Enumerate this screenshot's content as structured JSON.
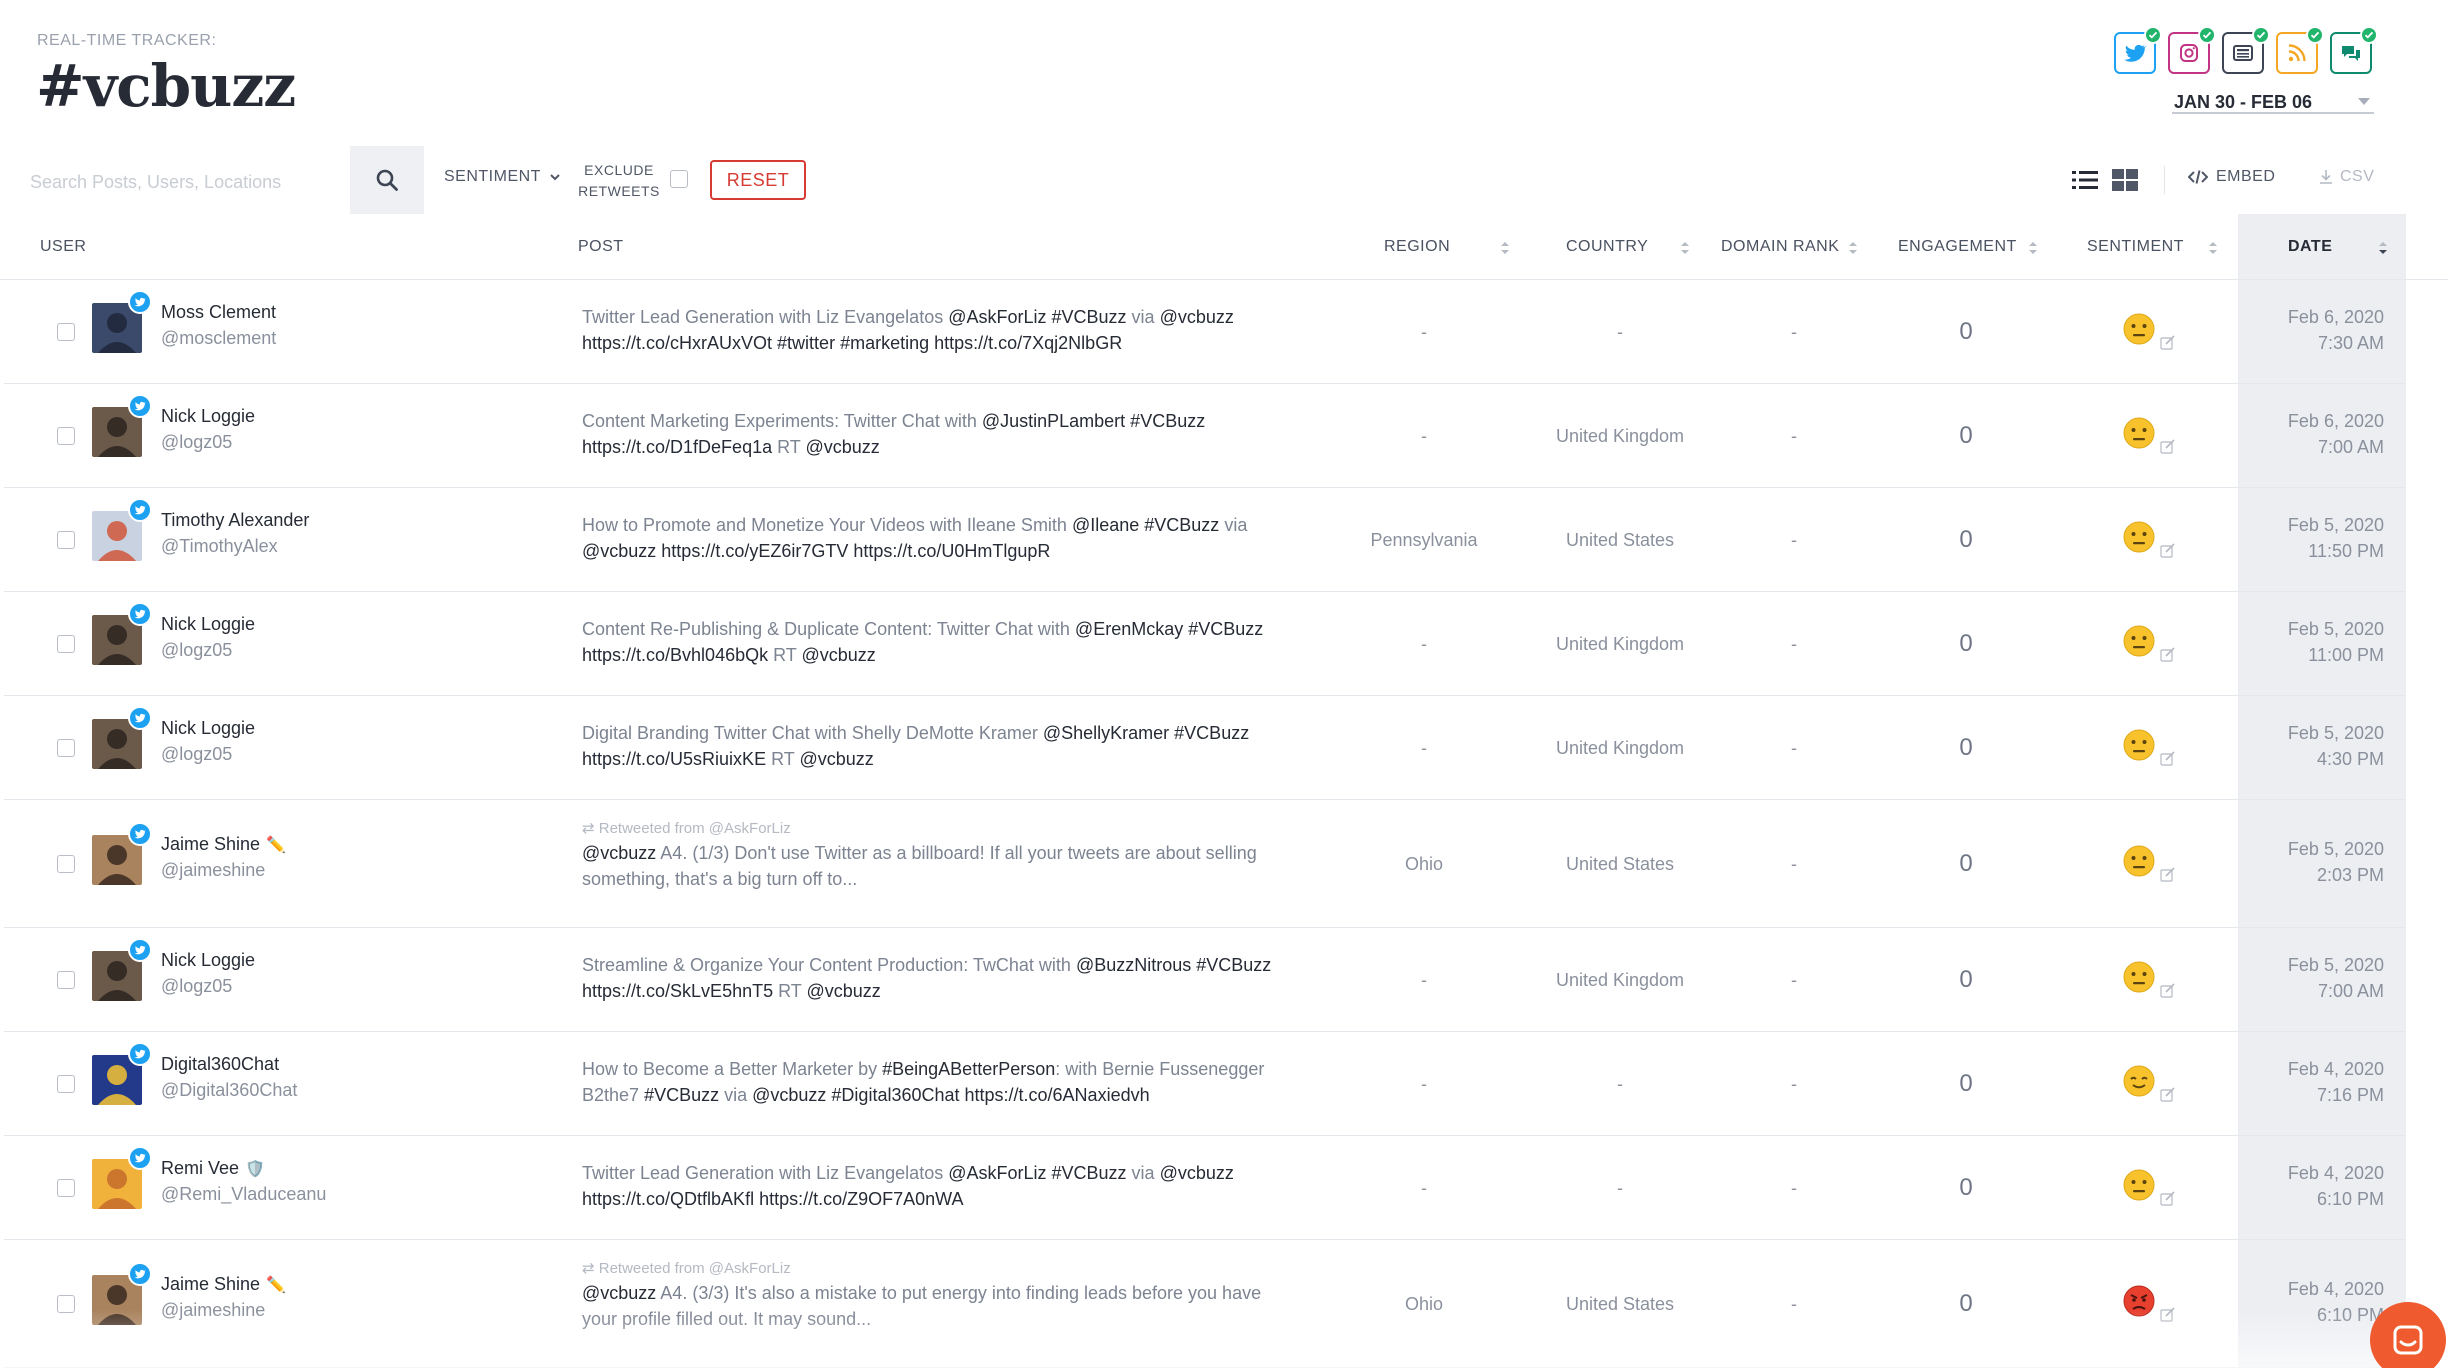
{
  "header": {
    "tracker_label": "REAL-TIME TRACKER:",
    "hashtag": "#vcbuzz",
    "date_range": "JAN 30 - FEB 06",
    "networks": [
      {
        "name": "twitter",
        "icon": "twitter-icon",
        "color": "#1da1f2"
      },
      {
        "name": "instagram",
        "icon": "instagram-icon",
        "color": "#c13584"
      },
      {
        "name": "news",
        "icon": "news-icon",
        "color": "#3d4454"
      },
      {
        "name": "rss",
        "icon": "rss-icon",
        "color": "#f5a623"
      },
      {
        "name": "forums",
        "icon": "forum-icon",
        "color": "#0f8a6e"
      }
    ]
  },
  "toolbar": {
    "search_placeholder": "Search Posts, Users, Locations",
    "sentiment_label": "SENTIMENT",
    "exclude_line1": "EXCLUDE",
    "exclude_line2": "RETWEETS",
    "reset_label": "RESET",
    "embed_label": "EMBED",
    "csv_label": "CSV"
  },
  "columns": {
    "user": "USER",
    "post": "POST",
    "region": "REGION",
    "country": "COUNTRY",
    "domain_rank": "DOMAIN RANK",
    "engagement": "ENGAGEMENT",
    "sentiment": "SENTIMENT",
    "date": "DATE"
  },
  "rows": [
    {
      "name": "Moss Clement",
      "handle": "@mosclement",
      "extra": "",
      "retweeted_from": "",
      "post_line1": [
        [
          "Twitter Lead Generation with Liz Evangelatos ",
          0
        ],
        [
          "@AskForLiz #VCBuzz",
          1
        ],
        [
          " via ",
          0
        ],
        [
          "@vcbuzz",
          1
        ]
      ],
      "post_line2": [
        [
          "https://t.co/cHxrAUxVOt #twitter #marketing https://t.co/7Xqj2NlbGR",
          1
        ]
      ],
      "region": "-",
      "country": "-",
      "domain_rank": "-",
      "engagement": "0",
      "sentiment": "neutral",
      "date": "Feb 6, 2020",
      "time": "7:30 AM"
    },
    {
      "name": "Nick Loggie",
      "handle": "@logz05",
      "extra": "",
      "retweeted_from": "",
      "post_line1": [
        [
          "Content Marketing Experiments: Twitter Chat with ",
          0
        ],
        [
          "@JustinPLambert #VCBuzz",
          1
        ]
      ],
      "post_line2": [
        [
          "https://t.co/D1fDeFeq1a",
          1
        ],
        [
          " RT ",
          0
        ],
        [
          "@vcbuzz",
          1
        ]
      ],
      "region": "-",
      "country": "United Kingdom",
      "domain_rank": "-",
      "engagement": "0",
      "sentiment": "neutral",
      "date": "Feb 6, 2020",
      "time": "7:00 AM"
    },
    {
      "name": "Timothy Alexander",
      "handle": "@TimothyAlex",
      "extra": "",
      "retweeted_from": "",
      "post_line1": [
        [
          "How to Promote and Monetize Your Videos with Ileane Smith ",
          0
        ],
        [
          "@Ileane #VCBuzz",
          1
        ],
        [
          " via",
          0
        ]
      ],
      "post_line2": [
        [
          "@vcbuzz https://t.co/yEZ6ir7GTV https://t.co/U0HmTlgupR",
          1
        ]
      ],
      "region": "Pennsylvania",
      "country": "United States",
      "domain_rank": "-",
      "engagement": "0",
      "sentiment": "neutral",
      "date": "Feb 5, 2020",
      "time": "11:50 PM"
    },
    {
      "name": "Nick Loggie",
      "handle": "@logz05",
      "extra": "",
      "retweeted_from": "",
      "post_line1": [
        [
          "Content Re-Publishing & Duplicate Content: Twitter Chat with ",
          0
        ],
        [
          "@ErenMckay #VCBuzz",
          1
        ]
      ],
      "post_line2": [
        [
          "https://t.co/Bvhl046bQk",
          1
        ],
        [
          " RT ",
          0
        ],
        [
          "@vcbuzz",
          1
        ]
      ],
      "region": "-",
      "country": "United Kingdom",
      "domain_rank": "-",
      "engagement": "0",
      "sentiment": "neutral",
      "date": "Feb 5, 2020",
      "time": "11:00 PM"
    },
    {
      "name": "Nick Loggie",
      "handle": "@logz05",
      "extra": "",
      "retweeted_from": "",
      "post_line1": [
        [
          "Digital Branding Twitter Chat with Shelly DeMotte Kramer ",
          0
        ],
        [
          "@ShellyKramer #VCBuzz",
          1
        ]
      ],
      "post_line2": [
        [
          "https://t.co/U5sRiuixKE",
          1
        ],
        [
          " RT ",
          0
        ],
        [
          "@vcbuzz",
          1
        ]
      ],
      "region": "-",
      "country": "United Kingdom",
      "domain_rank": "-",
      "engagement": "0",
      "sentiment": "neutral",
      "date": "Feb 5, 2020",
      "time": "4:30 PM"
    },
    {
      "name": "Jaime Shine",
      "handle": "@jaimeshine",
      "extra": "✏️",
      "retweeted_from": "Retweeted from @AskForLiz",
      "post_line1": [
        [
          "@vcbuzz",
          1
        ],
        [
          " A4. (1/3) Don't use Twitter as a billboard! If all your tweets are about selling",
          0
        ]
      ],
      "post_line2": [
        [
          "something, that's a big turn off to...",
          0
        ]
      ],
      "region": "Ohio",
      "country": "United States",
      "domain_rank": "-",
      "engagement": "0",
      "sentiment": "neutral",
      "date": "Feb 5, 2020",
      "time": "2:03 PM"
    },
    {
      "name": "Nick Loggie",
      "handle": "@logz05",
      "extra": "",
      "retweeted_from": "",
      "post_line1": [
        [
          "Streamline & Organize Your Content Production: TwChat with ",
          0
        ],
        [
          "@BuzzNitrous #VCBuzz",
          1
        ]
      ],
      "post_line2": [
        [
          "https://t.co/SkLvE5hnT5",
          1
        ],
        [
          " RT ",
          0
        ],
        [
          "@vcbuzz",
          1
        ]
      ],
      "region": "-",
      "country": "United Kingdom",
      "domain_rank": "-",
      "engagement": "0",
      "sentiment": "neutral",
      "date": "Feb 5, 2020",
      "time": "7:00 AM"
    },
    {
      "name": "Digital360Chat",
      "handle": "@Digital360Chat",
      "extra": "",
      "retweeted_from": "",
      "post_line1": [
        [
          "How to Become a Better Marketer by ",
          0
        ],
        [
          "#BeingABetterPerson",
          1
        ],
        [
          ": with Bernie Fussenegger",
          0
        ]
      ],
      "post_line2": [
        [
          "B2the7 ",
          0
        ],
        [
          "#VCBuzz",
          1
        ],
        [
          " via ",
          0
        ],
        [
          "@vcbuzz #Digital360Chat https://t.co/6ANaxiedvh",
          1
        ]
      ],
      "region": "-",
      "country": "-",
      "domain_rank": "-",
      "engagement": "0",
      "sentiment": "content",
      "date": "Feb 4, 2020",
      "time": "7:16 PM"
    },
    {
      "name": "Remi Vee",
      "handle": "@Remi_Vladuceanu",
      "extra": "🛡️",
      "retweeted_from": "",
      "post_line1": [
        [
          "Twitter Lead Generation with Liz Evangelatos ",
          0
        ],
        [
          "@AskForLiz #VCBuzz",
          1
        ],
        [
          " via ",
          0
        ],
        [
          "@vcbuzz",
          1
        ]
      ],
      "post_line2": [
        [
          "https://t.co/QDtflbAKfl https://t.co/Z9OF7A0nWA",
          1
        ]
      ],
      "region": "-",
      "country": "-",
      "domain_rank": "-",
      "engagement": "0",
      "sentiment": "neutral",
      "date": "Feb 4, 2020",
      "time": "6:10 PM"
    },
    {
      "name": "Jaime Shine",
      "handle": "@jaimeshine",
      "extra": "✏️",
      "retweeted_from": "Retweeted from @AskForLiz",
      "post_line1": [
        [
          "@vcbuzz",
          1
        ],
        [
          " A4. (3/3) It's also a mistake to put energy into finding leads before you have",
          0
        ]
      ],
      "post_line2": [
        [
          "your profile filled out. It may sound...",
          0
        ]
      ],
      "region": "Ohio",
      "country": "United States",
      "domain_rank": "-",
      "engagement": "0",
      "sentiment": "angry",
      "date": "Feb 4, 2020",
      "time": "6:10 PM"
    }
  ]
}
